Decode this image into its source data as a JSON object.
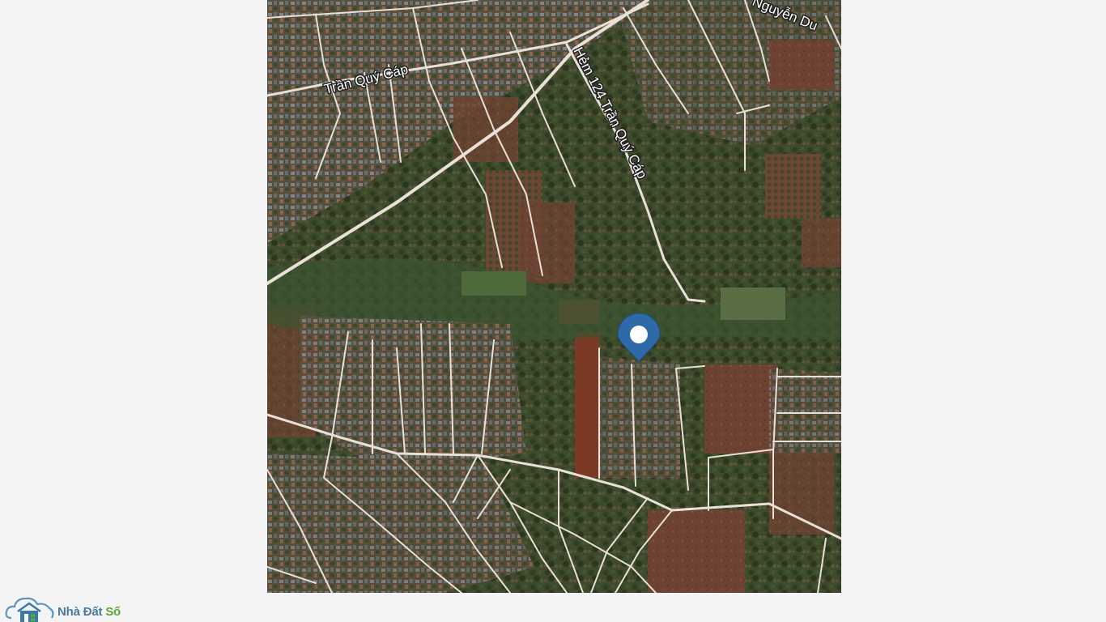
{
  "map": {
    "type": "satellite",
    "road_labels": {
      "main_road": "Trần Quý Cáp",
      "alley": "Hẻm 124 Trần Quý Cáp",
      "corner_road": "Nguyễn Du"
    },
    "marker": {
      "icon": "map-pin-icon",
      "color": "#2f6aa8"
    }
  },
  "watermark": {
    "icon": "house-cloud-icon",
    "brand_part1": "Nhà Đất",
    "brand_part2": "Số",
    "colors": {
      "part1": "#4a7a9a",
      "part2": "#5aa832"
    }
  }
}
